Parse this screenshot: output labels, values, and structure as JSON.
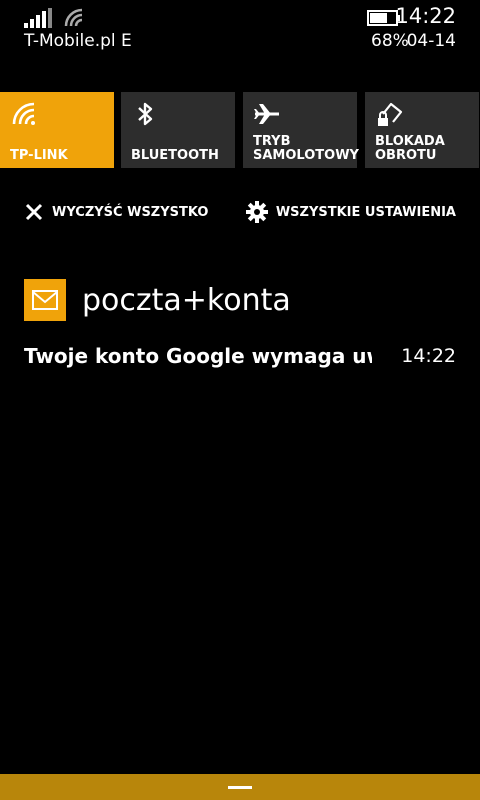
{
  "status_bar": {
    "carrier": "T-Mobile.pl E",
    "time": "14:22",
    "battery_percent": "68%",
    "battery_level": 0.68,
    "date": "04-14",
    "icons": [
      "signal-bars-icon",
      "wifi-signal-icon",
      "battery-icon"
    ]
  },
  "quick_actions": [
    {
      "label": "TP-LINK",
      "icon": "wifi-icon",
      "active": true
    },
    {
      "label": "BLUETOOTH",
      "icon": "bluetooth-icon",
      "active": false
    },
    {
      "label": "TRYB\nSAMOLOTOWY",
      "icon": "airplane-icon",
      "active": false
    },
    {
      "label": "BLOKADA\nOBROTU",
      "icon": "rotation-lock-icon",
      "active": false
    }
  ],
  "actions": {
    "clear_all": "WYCZYŚĆ WSZYSTKO",
    "all_settings": "WSZYSTKIE USTAWIENIA"
  },
  "notifications": {
    "app_name": "poczta+konta",
    "app_icon": "mail-icon",
    "item": {
      "text": "Twoje konto Google wymaga uwagi",
      "time": "14:22"
    }
  },
  "colors": {
    "accent": "#f0a30a",
    "tile_inactive": "#2d2d2d",
    "bottom_bar": "#b8860b",
    "background": "#000000"
  }
}
